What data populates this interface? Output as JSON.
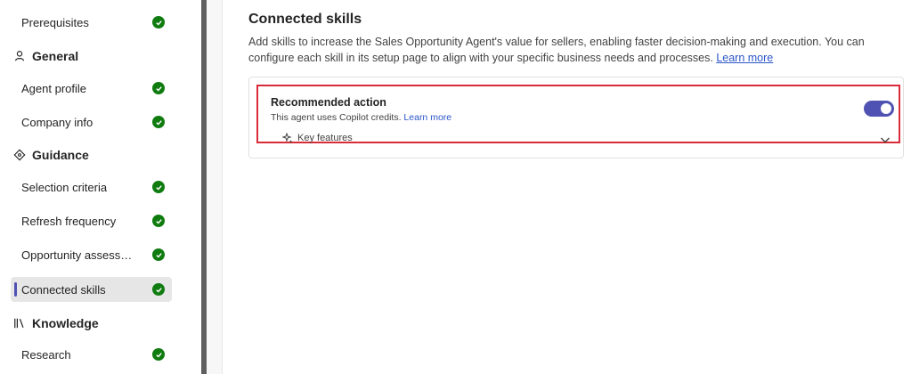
{
  "sidebar": {
    "items": [
      {
        "label": "Prerequisites",
        "status": "complete"
      },
      {
        "label": "Agent profile",
        "status": "complete"
      },
      {
        "label": "Company info",
        "status": "complete"
      },
      {
        "label": "Selection criteria",
        "status": "complete"
      },
      {
        "label": "Refresh frequency",
        "status": "complete"
      },
      {
        "label": "Opportunity assessme...",
        "status": "complete"
      },
      {
        "label": "Connected skills",
        "status": "complete",
        "selected": true
      },
      {
        "label": "Research",
        "status": "complete"
      }
    ],
    "sections": [
      {
        "label": "General",
        "icon": "person-icon"
      },
      {
        "label": "Guidance",
        "icon": "compass-icon"
      },
      {
        "label": "Knowledge",
        "icon": "library-icon"
      }
    ]
  },
  "main": {
    "title": "Connected skills",
    "description": "Add skills to increase the Sales Opportunity Agent's value for sellers, enabling faster decision-making and execution. You can configure each skill in its setup page to align with your specific business needs and processes.",
    "learn_more": "Learn more",
    "skill": {
      "title": "Recommended action",
      "subtitle": "This agent uses Copilot credits.",
      "subtitle_link": "Learn more",
      "toggle_on": true,
      "features_label": "Key features"
    }
  },
  "colors": {
    "accent": "#4f52b2",
    "success": "#107c10",
    "highlight": "#d92c3a",
    "link": "#2b56c8"
  }
}
